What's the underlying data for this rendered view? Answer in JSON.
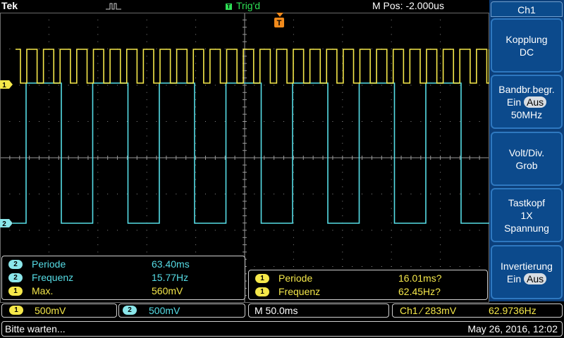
{
  "header": {
    "brand": "Tek",
    "trigger_status": "Trig'd",
    "trigger_letter": "T",
    "horizontal_position": "M Pos: -2.000us"
  },
  "markers": {
    "ch1": "1",
    "ch2": "2",
    "trigger": "T"
  },
  "menu": {
    "title": "Ch1",
    "coupling": {
      "label": "Kopplung",
      "value": "DC"
    },
    "bandwidth": {
      "label": "Bandbr.begr.",
      "on": "Ein",
      "off": "Aus",
      "value": "50MHz"
    },
    "volts_div": {
      "label": "Volt/Div.",
      "value": "Grob"
    },
    "probe": {
      "label": "Tastkopf",
      "value": "1X",
      "mode": "Spannung"
    },
    "invert": {
      "label": "Invertierung",
      "on": "Ein",
      "off": "Aus"
    }
  },
  "measurements_left": [
    {
      "channel": "2",
      "name": "Periode",
      "value": "63.40ms"
    },
    {
      "channel": "2",
      "name": "Frequenz",
      "value": "15.77Hz"
    },
    {
      "channel": "1",
      "name": "Max.",
      "value": "560mV"
    }
  ],
  "measurements_right": [
    {
      "channel": "1",
      "name": "Periode",
      "value": "16.01ms?"
    },
    {
      "channel": "1",
      "name": "Frequenz",
      "value": "62.45Hz?"
    }
  ],
  "status": {
    "ch1_badge": "1",
    "ch1_scale": "500mV",
    "ch2_badge": "2",
    "ch2_scale": "500mV",
    "timebase": "M 50.0ms",
    "trigger": "Ch1 ⁄ 283mV",
    "trigger_freq": "62.9736Hz"
  },
  "footer": {
    "message": "Bitte warten...",
    "datetime": "May 26, 2016, 12:02"
  },
  "colors": {
    "ch1": "#f5e84a",
    "ch2": "#56dde6",
    "trigger": "#f08a1c",
    "menu": "#0c3f7a"
  }
}
